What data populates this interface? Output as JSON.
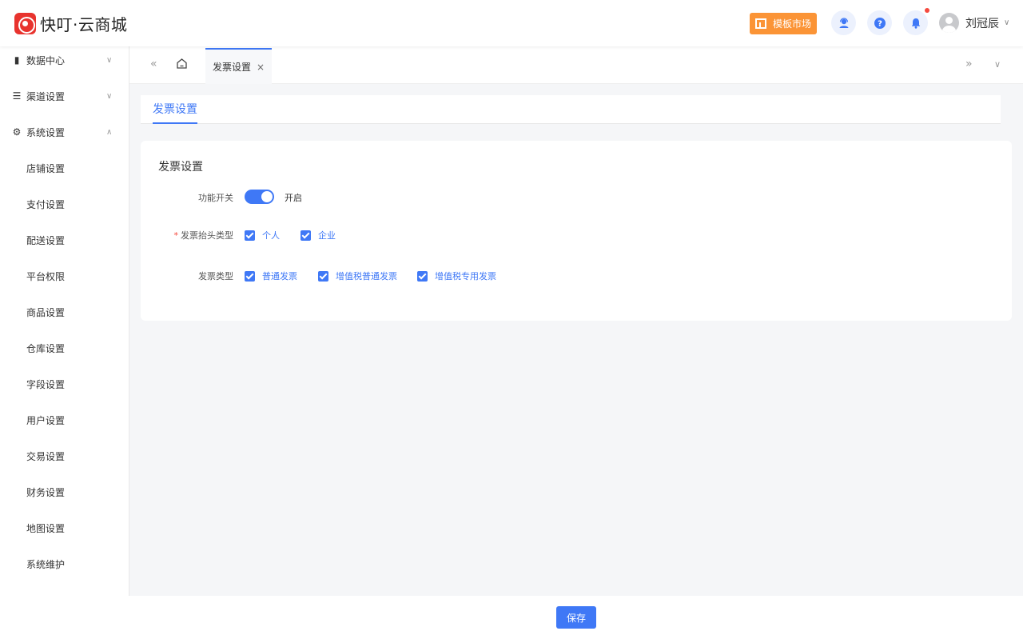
{
  "header": {
    "logo_text": "快叮·云商城",
    "market_label": "模板市场",
    "user_name": "刘冠辰"
  },
  "sidebar": {
    "groups": [
      {
        "label": "数据中心",
        "icon": "bar-chart-icon",
        "expanded": false
      },
      {
        "label": "渠道设置",
        "icon": "list-icon",
        "expanded": false
      },
      {
        "label": "系统设置",
        "icon": "gear-icon",
        "expanded": true
      }
    ],
    "sub_items": [
      "店铺设置",
      "支付设置",
      "配送设置",
      "平台权限",
      "商品设置",
      "仓库设置",
      "字段设置",
      "用户设置",
      "交易设置",
      "财务设置",
      "地图设置",
      "系统维护"
    ]
  },
  "tabs": {
    "active_tab": "发票设置"
  },
  "sub_tab": "发票设置",
  "form": {
    "title": "发票设置",
    "switch_label": "功能开关",
    "switch_text": "开启",
    "header_type_label": "发票抬头类型",
    "header_types": [
      "个人",
      "企业"
    ],
    "invoice_type_label": "发票类型",
    "invoice_types": [
      "普通发票",
      "增值税普通发票",
      "增值税专用发票"
    ]
  },
  "footer": {
    "save_label": "保存"
  },
  "colors": {
    "primary": "#3f78f6",
    "market": "#fb9436",
    "logo": "#e8332e"
  }
}
